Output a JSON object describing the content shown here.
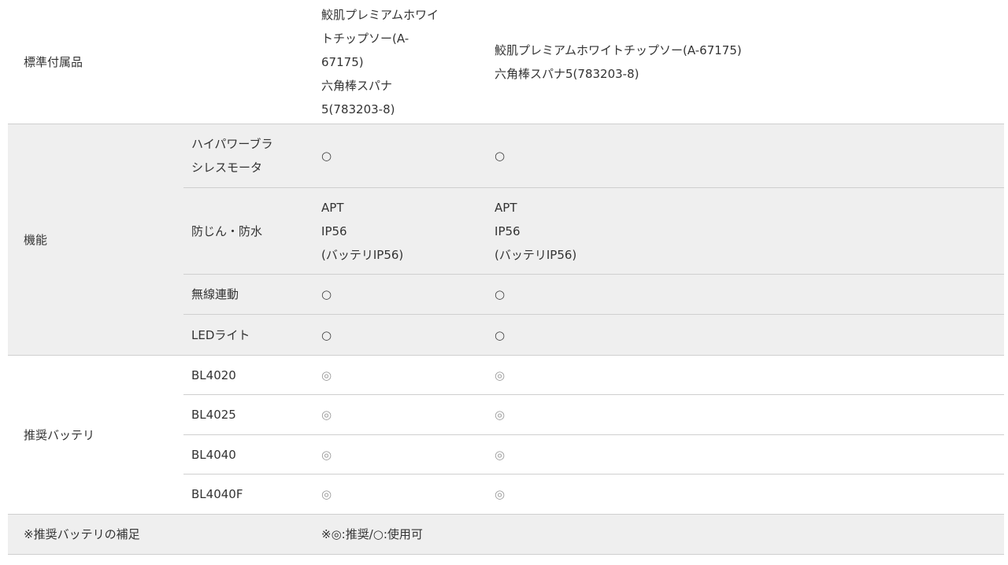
{
  "accessories": {
    "label": "標準付属品",
    "col1": [
      "鮫肌プレミアムホワイ",
      "トチップソー(A-",
      "67175)",
      "六角棒スパナ",
      "5(783203-8)"
    ],
    "col2": [
      "鮫肌プレミアムホワイトチップソー(A-67175)",
      "六角棒スパナ5(783203-8)"
    ]
  },
  "features": {
    "label": "機能",
    "rows": [
      {
        "name": [
          "ハイパワーブラ",
          "シレスモータ"
        ],
        "col1": [
          "○"
        ],
        "col2": [
          "○"
        ]
      },
      {
        "name": [
          "防じん・防水"
        ],
        "col1": [
          "APT",
          "IP56",
          "(バッテリIP56)"
        ],
        "col2": [
          "APT",
          "IP56",
          "(バッテリIP56)"
        ]
      },
      {
        "name": [
          "無線連動"
        ],
        "col1": [
          "○"
        ],
        "col2": [
          "○"
        ]
      },
      {
        "name": [
          "LEDライト"
        ],
        "col1": [
          "○"
        ],
        "col2": [
          "○"
        ]
      }
    ]
  },
  "battery": {
    "label": "推奨バッテリ",
    "rows": [
      {
        "name": "BL4020",
        "col1": "◎",
        "col2": "◎"
      },
      {
        "name": "BL4025",
        "col1": "◎",
        "col2": "◎"
      },
      {
        "name": "BL4040",
        "col1": "◎",
        "col2": "◎"
      },
      {
        "name": "BL4040F",
        "col1": "◎",
        "col2": "◎"
      }
    ]
  },
  "note": {
    "label": "※推奨バッテリの補足",
    "value": "※◎:推奨/○:使用可"
  }
}
